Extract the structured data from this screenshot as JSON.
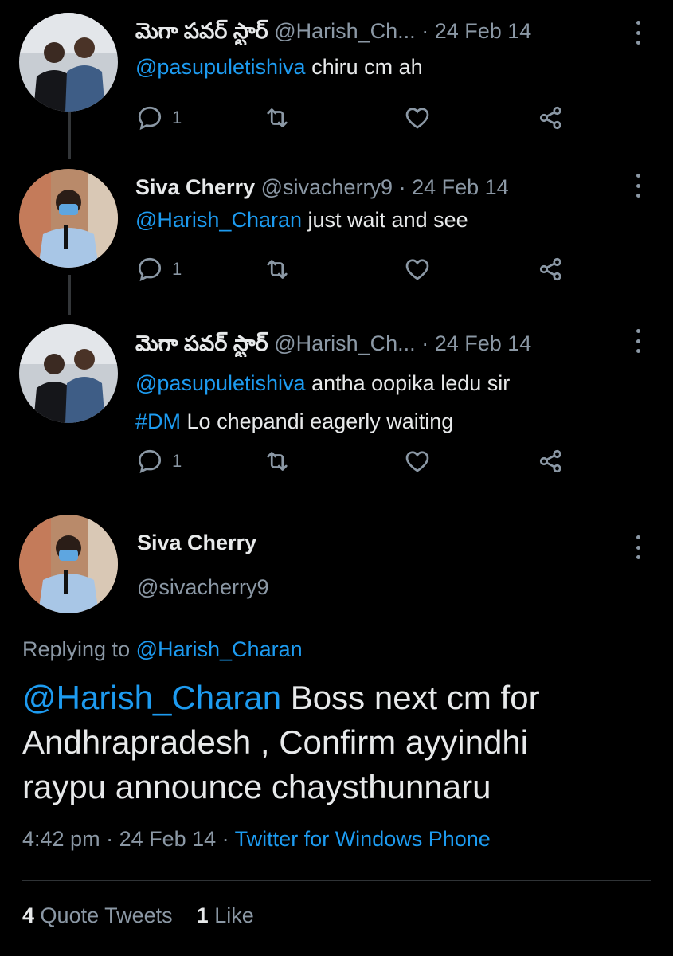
{
  "accent": "#1d9bf0",
  "replies": [
    {
      "name": "మెగా పవర్ స్టార్",
      "handle": "@Harish_Ch...",
      "date": "· 24 Feb 14",
      "mention": "@pasupuletishiva",
      "text": "chiru cm ah",
      "line2_tag": "",
      "line2_text": "",
      "reply_count": "1"
    },
    {
      "name": "Siva Cherry",
      "handle": "@sivacherry9",
      "date": "· 24 Feb 14",
      "mention": "@Harish_Charan",
      "text": "just wait and see",
      "line2_tag": "",
      "line2_text": "",
      "reply_count": "1"
    },
    {
      "name": "మెగా పవర్ స్టార్",
      "handle": "@Harish_Ch...",
      "date": "· 24 Feb 14",
      "mention": "@pasupuletishiva",
      "text": "antha oopika ledu sir",
      "line2_tag": "#DM",
      "line2_text": "Lo chepandi  eagerly waiting",
      "reply_count": "1"
    }
  ],
  "main": {
    "name": "Siva Cherry",
    "handle": "@sivacherry9",
    "replying_prefix": "Replying to",
    "replying_to": "@Harish_Charan",
    "mention": "@Harish_Charan",
    "text_rest": "Boss next cm for",
    "text_line2": "Andhrapradesh , Confirm ayyindhi",
    "text_line3": "raypu announce chaysthunnaru",
    "time": "4:42 pm",
    "date": "· 24 Feb 14 ·",
    "source": "Twitter for Windows Phone",
    "quote_count": "4",
    "quote_label": "Quote Tweets",
    "like_count": "1",
    "like_label": "Like"
  }
}
